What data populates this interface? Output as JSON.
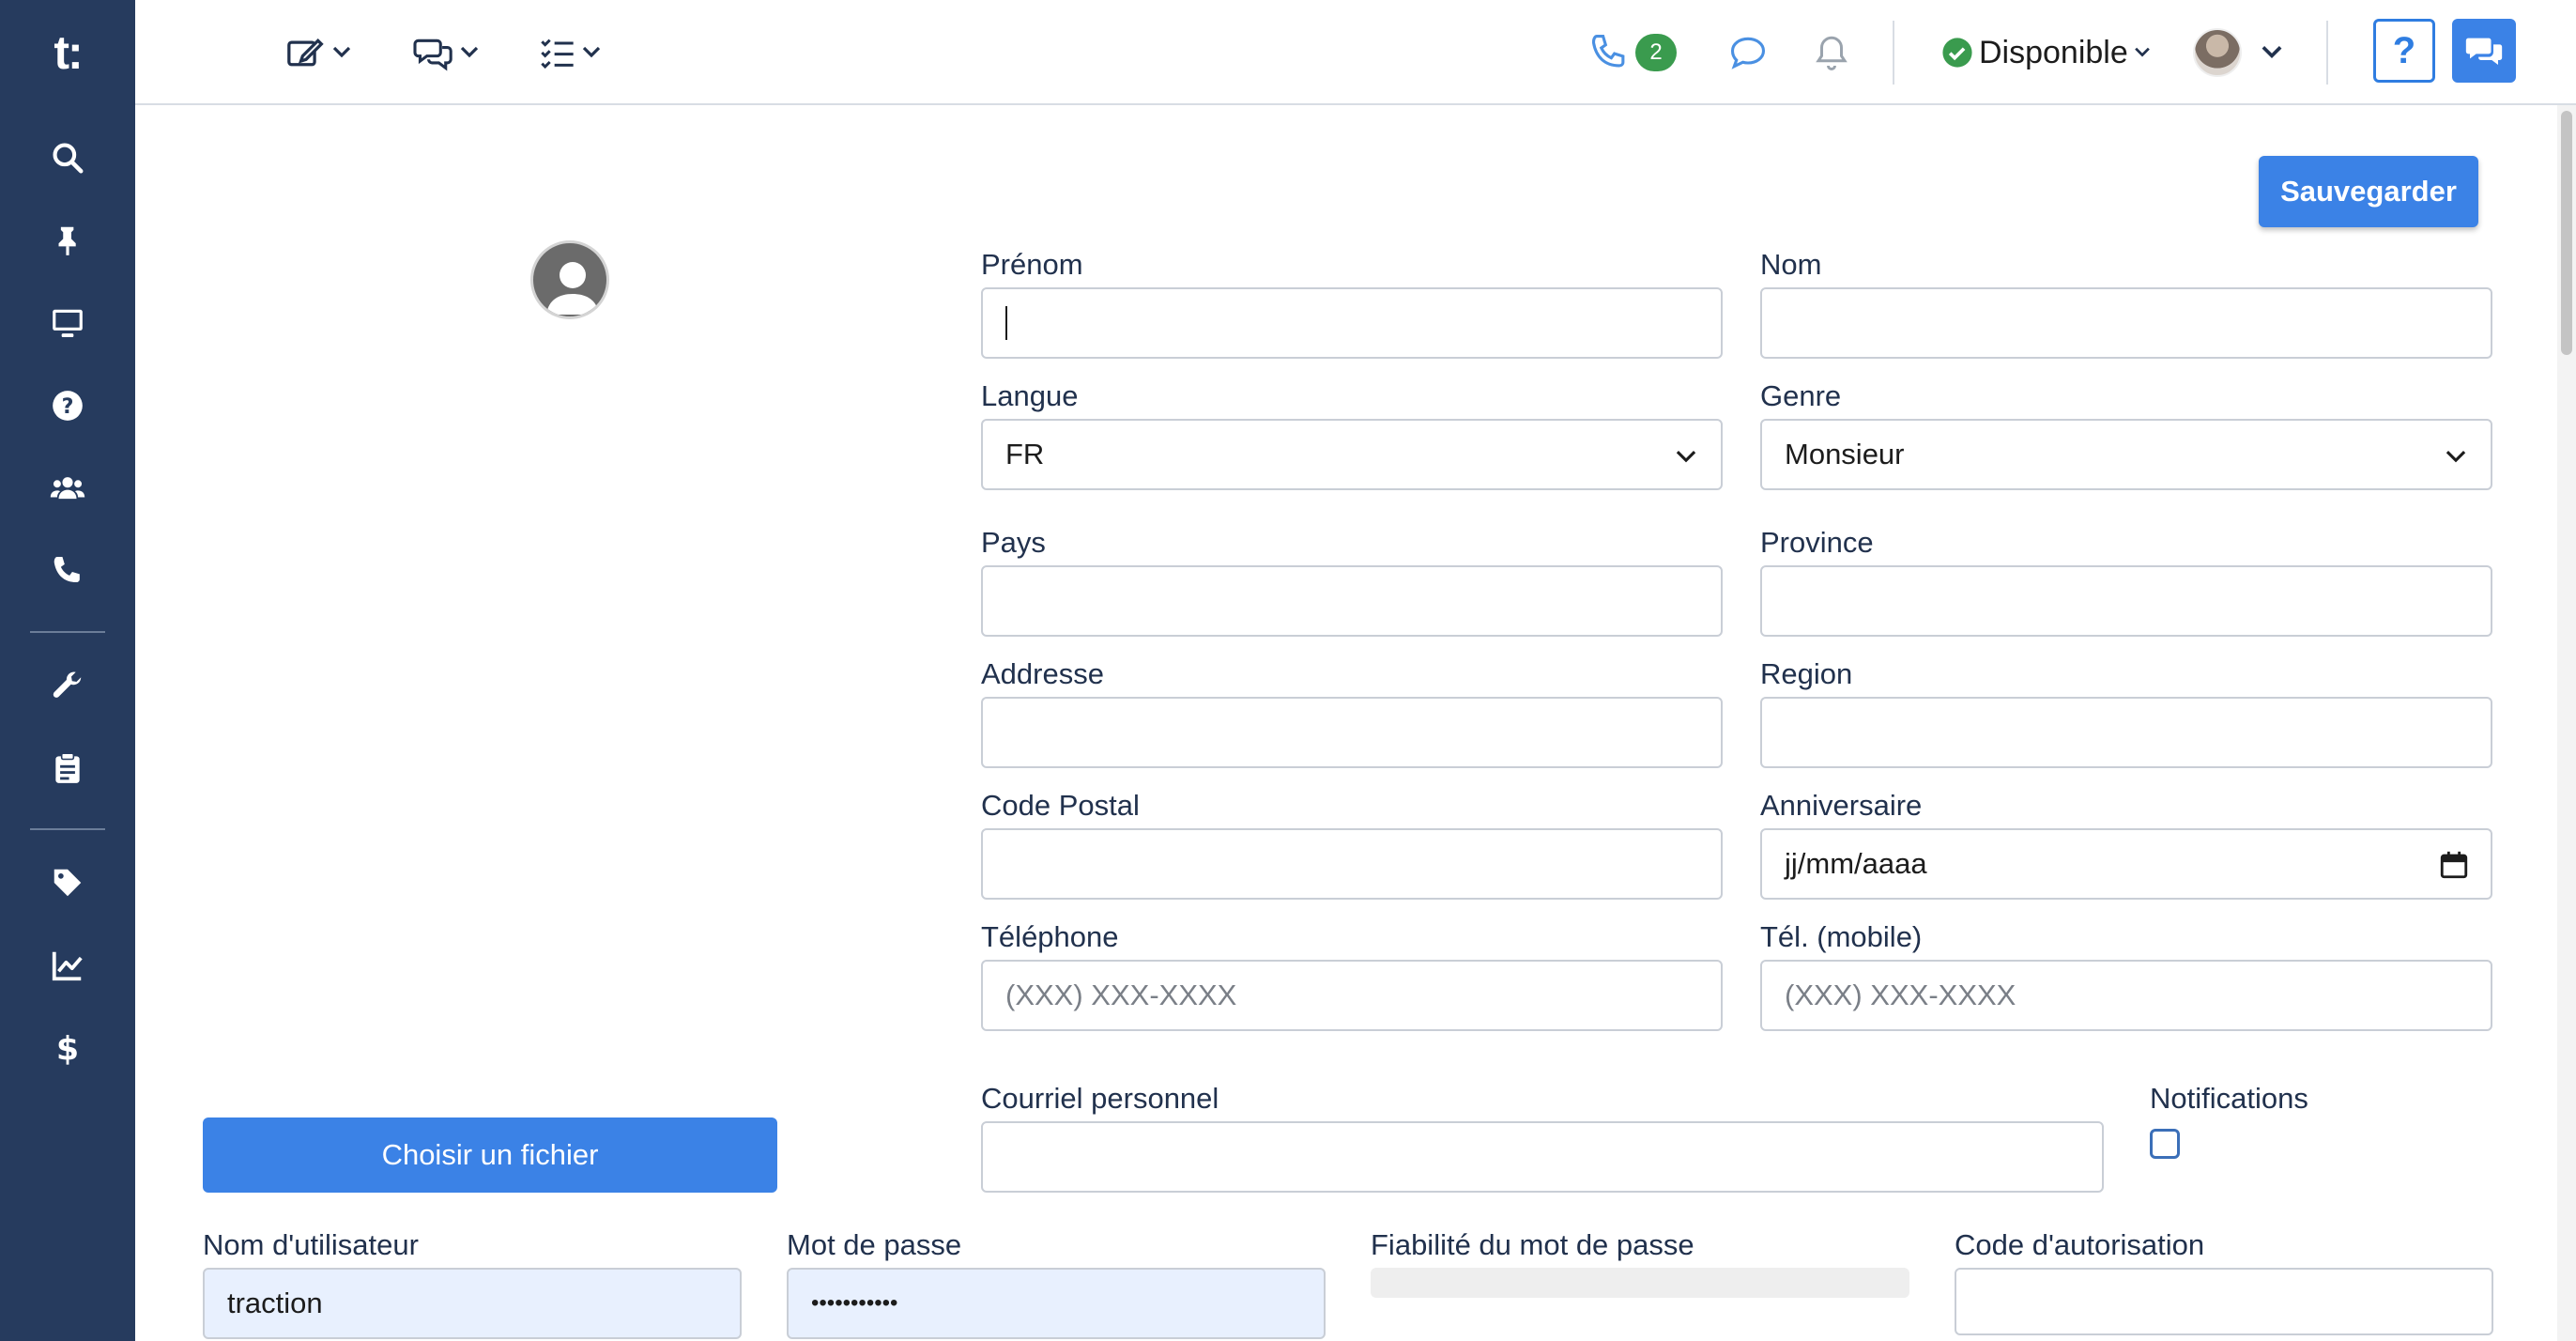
{
  "sidebar": {
    "logo": "t:",
    "items": [
      {
        "icon": "search-icon"
      },
      {
        "icon": "pin-icon"
      },
      {
        "icon": "monitor-icon"
      },
      {
        "icon": "help-circle-icon"
      },
      {
        "icon": "users-icon"
      },
      {
        "icon": "phone-icon"
      },
      {
        "icon": "wrench-icon"
      },
      {
        "icon": "clipboard-icon"
      },
      {
        "icon": "tag-icon"
      },
      {
        "icon": "chart-line-icon"
      },
      {
        "icon": "dollar-icon"
      }
    ]
  },
  "topbar": {
    "calls_badge": "2",
    "status_label": "Disponible",
    "status_color": "#3a9b4e",
    "help_label": "?"
  },
  "form": {
    "save_label": "Sauvegarder",
    "choose_file_label": "Choisir un fichier",
    "prenom": {
      "label": "Prénom",
      "value": ""
    },
    "nom": {
      "label": "Nom",
      "value": ""
    },
    "langue": {
      "label": "Langue",
      "value": "FR"
    },
    "genre": {
      "label": "Genre",
      "value": "Monsieur"
    },
    "pays": {
      "label": "Pays",
      "value": ""
    },
    "province": {
      "label": "Province",
      "value": ""
    },
    "addresse": {
      "label": "Addresse",
      "value": ""
    },
    "region": {
      "label": "Region",
      "value": ""
    },
    "code_postal": {
      "label": "Code Postal",
      "value": ""
    },
    "anniversaire": {
      "label": "Anniversaire",
      "value": "jj/mm/aaaa"
    },
    "telephone": {
      "label": "Téléphone",
      "placeholder": "(XXX) XXX-XXXX"
    },
    "tel_mobile": {
      "label": "Tél. (mobile)",
      "placeholder": "(XXX) XXX-XXXX"
    },
    "courriel": {
      "label": "Courriel personnel",
      "value": ""
    },
    "notifications": {
      "label": "Notifications"
    },
    "username": {
      "label": "Nom d'utilisateur",
      "value": "traction"
    },
    "password": {
      "label": "Mot de passe",
      "value": "•••••••••••"
    },
    "password_strength": {
      "label": "Fiabilité du mot de passe"
    },
    "auth_code": {
      "label": "Code d'autorisation",
      "value": ""
    }
  },
  "colors": {
    "sidebar_bg": "#263b5e",
    "accent": "#3b82e6"
  }
}
